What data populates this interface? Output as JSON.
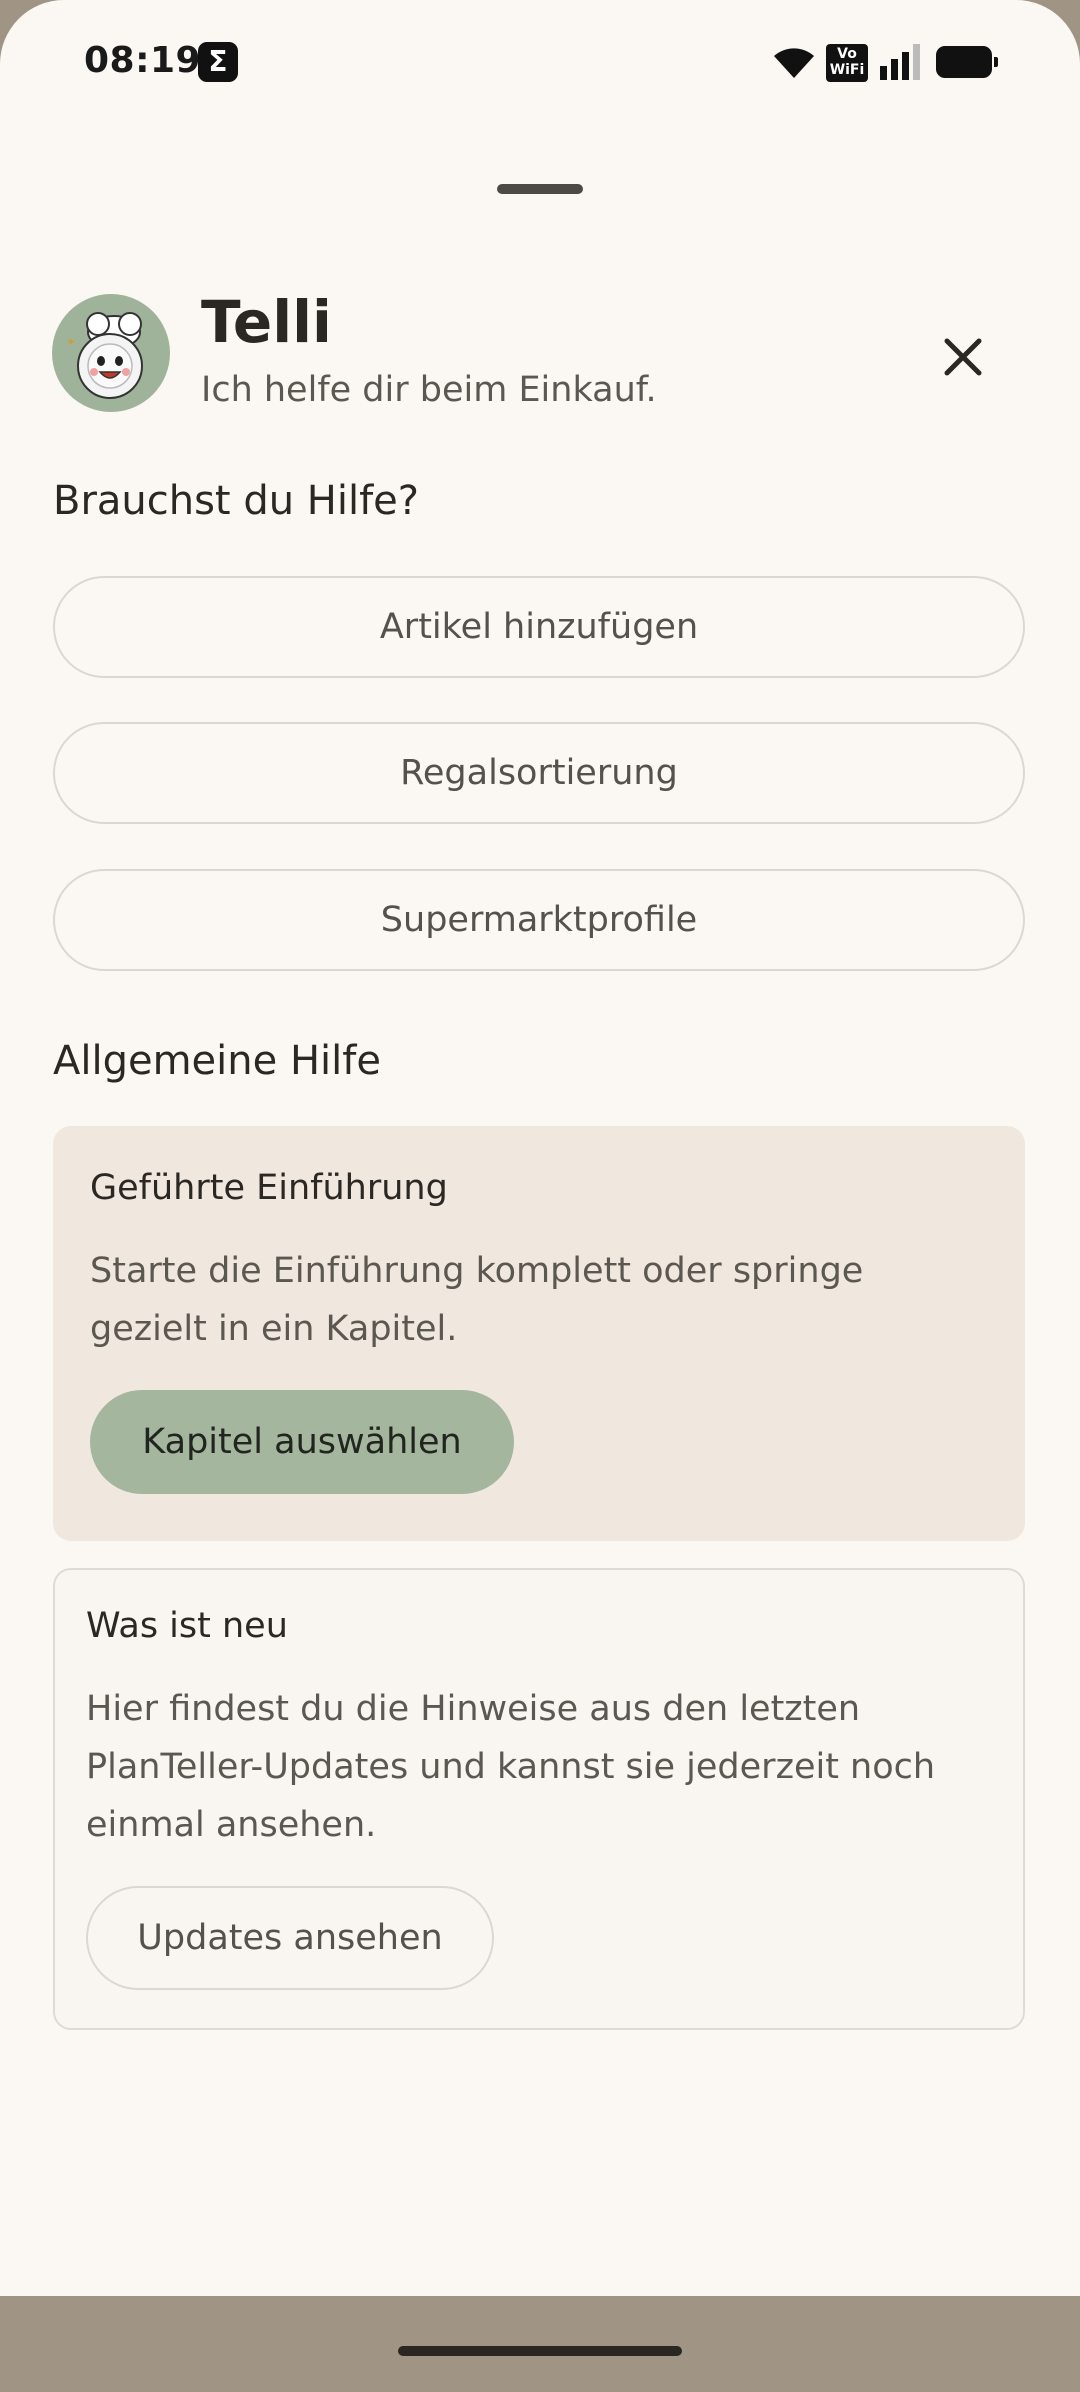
{
  "status_bar": {
    "time": "08:19",
    "notification_icon": "sigma-icon",
    "vowifi_label": "Vo WiFi",
    "icons": [
      "wifi-icon",
      "vowifi-icon",
      "signal-icon",
      "battery-icon"
    ]
  },
  "header": {
    "title": "Telli",
    "subtitle": "Ich helfe dir beim Einkauf.",
    "avatar_icon": "chef-mascot-icon",
    "close_icon": "close-icon"
  },
  "help_section": {
    "title": "Brauchst du Hilfe?",
    "buttons": [
      {
        "label": "Artikel hinzufügen"
      },
      {
        "label": "Regalsortierung"
      },
      {
        "label": "Supermarktprofile"
      }
    ]
  },
  "general_section": {
    "title": "Allgemeine Hilfe",
    "intro_card": {
      "title": "Geführte Einführung",
      "text": "Starte die Einführung komplett oder springe gezielt in ein Kapitel.",
      "button": "Kapitel auswählen"
    },
    "news_card": {
      "title": "Was ist neu",
      "text": "Hier findest du die Hinweise aus den letzten PlanTeller-Updates und kannst sie jederzeit noch einmal ansehen.",
      "button": "Updates ansehen"
    }
  },
  "colors": {
    "sheet_background": "#fbf8f4",
    "intro_card_background": "#f0e7de",
    "accent_button": "#a4b69e",
    "nav_bar": "#a09585",
    "avatar_background": "#9fb39b"
  }
}
